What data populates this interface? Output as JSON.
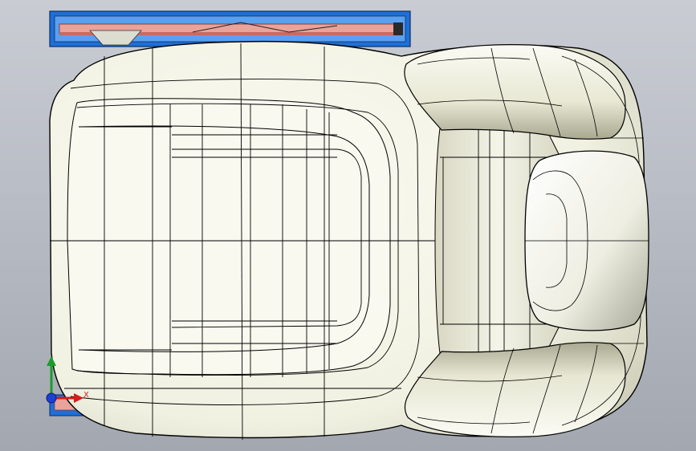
{
  "viewport": {
    "background_top": "#c9ccd3",
    "background_bottom": "#a3a7b0",
    "model_surface_color": "#f7f7ec",
    "edge_line_color": "#000000",
    "frame_color": "#1f6fd6",
    "rail_color": "#e9a39a"
  },
  "triad": {
    "x_label": "X",
    "x_color": "#d41c1c",
    "y_color": "#1a9c2a",
    "z_color": "#1c3fd4"
  }
}
